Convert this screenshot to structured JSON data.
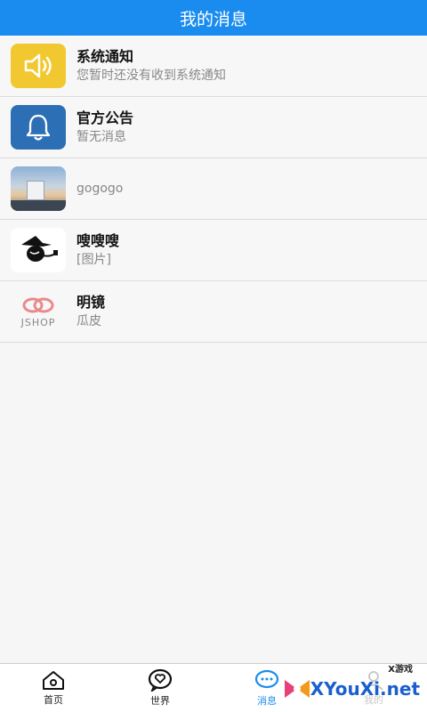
{
  "header": {
    "title": "我的消息"
  },
  "messages": [
    {
      "title": "系统通知",
      "subtitle": "您暂时还没有收到系统通知",
      "icon": "speaker-icon"
    },
    {
      "title": "官方公告",
      "subtitle": "暂无消息",
      "icon": "bell-icon"
    },
    {
      "title": "",
      "subtitle": "gogogo",
      "icon": "truck-photo-avatar"
    },
    {
      "title": "嗖嗖嗖",
      "subtitle": "[图片]",
      "icon": "witch-avatar"
    },
    {
      "title": "明镜",
      "subtitle": "瓜皮",
      "icon": "jshop-logo",
      "logo_text": "JSHOP"
    }
  ],
  "tabbar": {
    "tabs": [
      {
        "label": "首页",
        "icon": "home-icon"
      },
      {
        "label": "世界",
        "icon": "heart-chat-icon"
      },
      {
        "label": "消息",
        "icon": "message-icon",
        "active": true
      },
      {
        "label": "我的",
        "icon": "user-icon"
      }
    ]
  },
  "watermark": {
    "brand": "XYouXi.net",
    "small": "X游戏"
  },
  "colors": {
    "accent": "#1a8cf0",
    "yellow": "#f2c830",
    "blue": "#2c6fb5"
  }
}
